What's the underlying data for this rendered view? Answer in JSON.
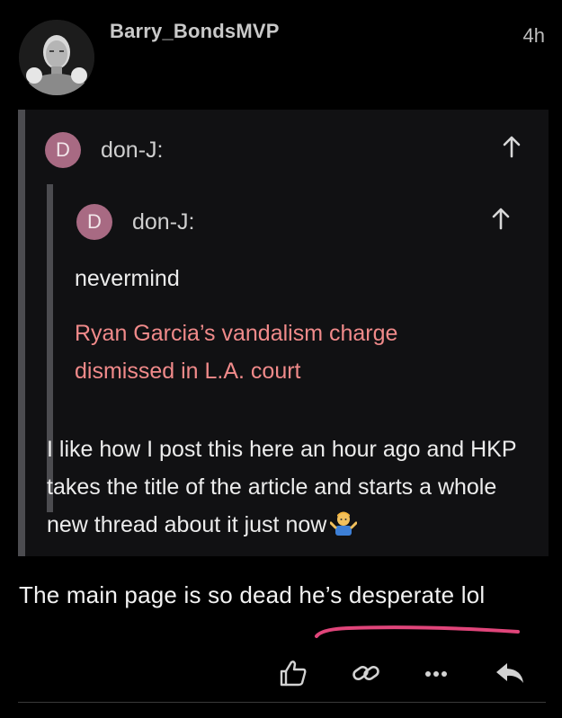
{
  "post": {
    "username": "Barry_BondsMVP",
    "timestamp": "4h",
    "body": "The main page is so dead he’s desperate lol"
  },
  "quote": {
    "author": "don-J:",
    "badge_letter": "D",
    "body": "I like how I post this here an hour ago and HKP takes the title of the article and starts a whole new thread about it just now",
    "emoji": "person-shrugging-emoji",
    "nested": {
      "author": "don-J:",
      "badge_letter": "D",
      "text": "nevermind",
      "link": "Ryan Garcia’s vandalism charge dismissed in L.A. court"
    }
  },
  "actions": {
    "icons": [
      "thumbs-up-icon",
      "link-icon",
      "more-icon",
      "reply-icon"
    ]
  },
  "colors": {
    "background": "#000000",
    "quote_background": "#111113",
    "quote_bar": "#4c4c50",
    "badge": "#a86a83",
    "link": "#f08a8a",
    "annotation_underline": "#e0457a"
  }
}
